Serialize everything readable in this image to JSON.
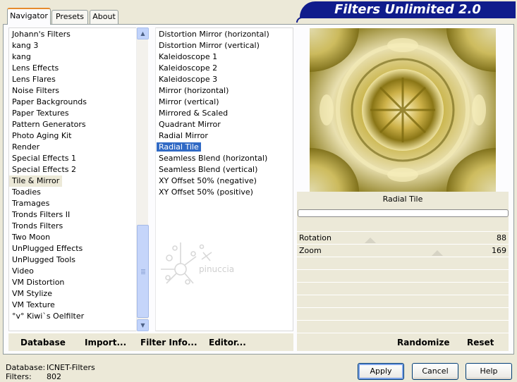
{
  "tabs": [
    "Navigator",
    "Presets",
    "About"
  ],
  "app_title": "Filters Unlimited 2.0",
  "categories": [
    "Johann's Filters",
    "kang 3",
    "kang",
    "Lens Effects",
    "Lens Flares",
    "Noise Filters",
    "Paper Backgrounds",
    "Paper Textures",
    "Pattern Generators",
    "Photo Aging Kit",
    "Render",
    "Special Effects 1",
    "Special Effects 2",
    "Tile & Mirror",
    "Toadies",
    "Tramages",
    "Tronds Filters II",
    "Tronds Filters",
    "Two Moon",
    "UnPlugged Effects",
    "UnPlugged Tools",
    "Video",
    "VM Distortion",
    "VM Stylize",
    "VM Texture",
    "°v° Kiwi`s Oelfilter"
  ],
  "selected_category": "Tile & Mirror",
  "filters": [
    "Distortion Mirror (horizontal)",
    "Distortion Mirror (vertical)",
    "Kaleidoscope 1",
    "Kaleidoscope 2",
    "Kaleidoscope 3",
    "Mirror (horizontal)",
    "Mirror (vertical)",
    "Mirrored & Scaled",
    "Quadrant Mirror",
    "Radial Mirror",
    "Radial Tile",
    "Seamless Blend (horizontal)",
    "Seamless Blend (vertical)",
    "XY Offset 50% (negative)",
    "XY Offset 50% (positive)"
  ],
  "selected_filter": "Radial Tile",
  "preview_title": "Radial Tile",
  "watermark_text": "pinuccia",
  "params": [
    {
      "label": "Rotation",
      "value": "88",
      "fraction": 0.345
    },
    {
      "label": "Zoom",
      "value": "169",
      "fraction": 0.663
    }
  ],
  "bottom_buttons": {
    "database": "Database",
    "import": "Import...",
    "filter_info": "Filter Info...",
    "editor": "Editor...",
    "randomize": "Randomize",
    "reset": "Reset"
  },
  "status": {
    "database_label": "Database:",
    "database_value": "ICNET-Filters",
    "filters_label": "Filters:",
    "filters_value": "802"
  },
  "dialog_buttons": {
    "apply": "Apply",
    "cancel": "Cancel",
    "help": "Help"
  },
  "colors": {
    "banner": "#101c8c",
    "selection": "#316ac5",
    "tab_highlight": "#e68b2c"
  }
}
